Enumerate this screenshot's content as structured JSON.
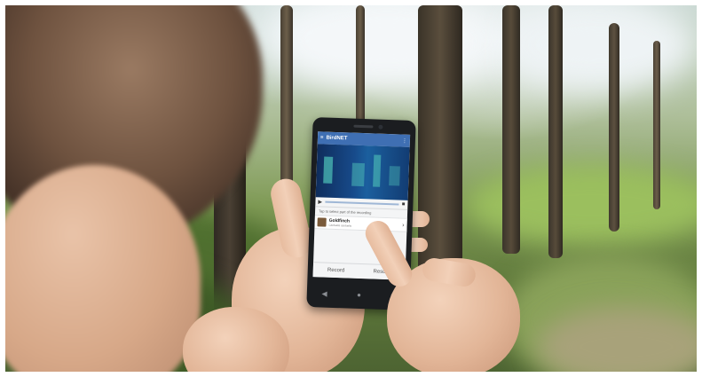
{
  "app": {
    "title": "BirdNET",
    "menu_icon": "hamburger-icon",
    "more_icon": "more-vert-icon",
    "play_icon": "play-icon",
    "stop_icon": "stop-icon",
    "hint": "Tap to select part of the recording",
    "result": {
      "name": "Goldfinch",
      "scientific": "Carduelis carduelis"
    },
    "nav": [
      "Record",
      "Results"
    ],
    "system_keys": [
      "◀",
      "●",
      "■"
    ]
  },
  "colors": {
    "app_bar": "#3f6fb3",
    "spectrogram": "#174a8a",
    "foliage": "#6f8f45",
    "skin": "#e2b597"
  }
}
